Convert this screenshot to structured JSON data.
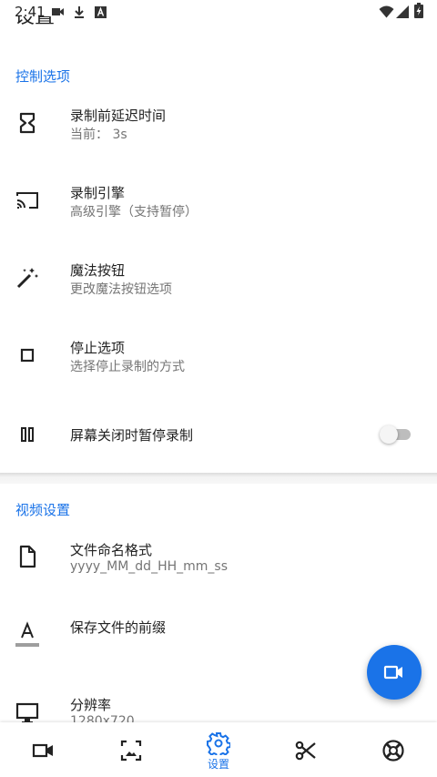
{
  "status_bar": {
    "time": "2:41",
    "left_icons": [
      "video-record-icon",
      "download-icon",
      "a-badge-icon"
    ],
    "right_icons": [
      "wifi-icon",
      "signal-icon",
      "battery-charging-icon"
    ]
  },
  "page": {
    "title": "设置"
  },
  "sections": {
    "control": {
      "header": "控制选项",
      "items": [
        {
          "icon": "hourglass-icon",
          "title": "录制前延迟时间",
          "subtitle": "当前： 3s"
        },
        {
          "icon": "cast-icon",
          "title": "录制引擎",
          "subtitle": "高级引擎（支持暂停）"
        },
        {
          "icon": "magic-wand-icon",
          "title": "魔法按钮",
          "subtitle": "更改魔法按钮选项"
        },
        {
          "icon": "stop-icon",
          "title": "停止选项",
          "subtitle": "选择停止录制的方式"
        },
        {
          "icon": "pause-icon",
          "title": "屏幕关闭时暂停录制",
          "toggle": false
        }
      ]
    },
    "video": {
      "header": "视频设置",
      "items": [
        {
          "icon": "file-icon",
          "title": "文件命名格式",
          "subtitle": "yyyy_MM_dd_HH_mm_ss"
        },
        {
          "icon": "text-format-icon",
          "title": "保存文件的前缀"
        },
        {
          "icon": "monitor-icon",
          "title": "分辨率",
          "subtitle": "1280x720"
        }
      ]
    }
  },
  "fab": {
    "icon": "video-camera-icon"
  },
  "bottom_nav": {
    "items": [
      {
        "icon": "video-camera-icon",
        "label": ""
      },
      {
        "icon": "gallery-icon",
        "label": ""
      },
      {
        "icon": "settings-icon",
        "label": "设置",
        "active": true
      },
      {
        "icon": "scissors-icon",
        "label": ""
      },
      {
        "icon": "lifebuoy-icon",
        "label": ""
      }
    ]
  },
  "colors": {
    "accent": "#1a73e8",
    "primary_text": "#222222",
    "secondary_text": "#757575",
    "toggle_off": "#bdbdbd"
  }
}
